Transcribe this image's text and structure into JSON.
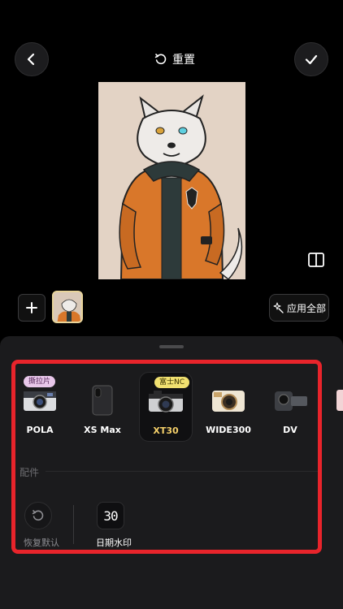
{
  "header": {
    "reset_label": "重置",
    "back_icon": "chevron-left-icon",
    "confirm_icon": "check-icon"
  },
  "toolbar": {
    "add_icon": "plus-icon",
    "apply_all_label": "应用全部"
  },
  "cameras": [
    {
      "name": "POLA",
      "badge": "撕拉片",
      "selected": false
    },
    {
      "name": "XS Max",
      "badge": "",
      "selected": false
    },
    {
      "name": "XT30",
      "badge": "富士NC",
      "selected": true
    },
    {
      "name": "WIDE300",
      "badge": "",
      "selected": false
    },
    {
      "name": "DV",
      "badge": "",
      "selected": false
    }
  ],
  "accessories": {
    "section_label": "配件",
    "items": [
      {
        "label": "恢复默认",
        "icon": "reset-icon"
      },
      {
        "label": "日期水印",
        "icon": "date-30-icon",
        "icon_text": "30"
      }
    ]
  },
  "colors": {
    "highlight": "#e8242b",
    "selected_text": "#f5d06a",
    "panel_bg": "#1b1b1d"
  }
}
